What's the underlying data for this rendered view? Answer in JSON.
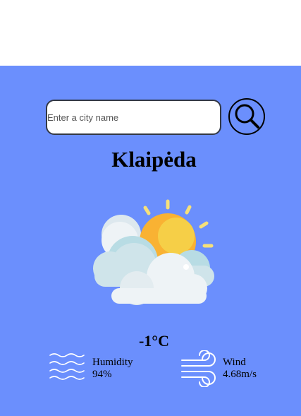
{
  "search": {
    "placeholder": "Enter a city name",
    "value": "",
    "button_icon": "search-icon"
  },
  "weather": {
    "city": "Klaipėda",
    "condition_icon": "partly-cloudy-sun-icon",
    "temperature": "-1°C",
    "humidity": {
      "icon": "waves-icon",
      "value": "94%",
      "label": "Humidity"
    },
    "wind": {
      "icon": "wind-icon",
      "value": "4.68m/s",
      "label": "Wind"
    }
  },
  "colors": {
    "card_background": "#6b8ffd",
    "sun": "#f9b233",
    "cloud": "#eef3f6"
  }
}
